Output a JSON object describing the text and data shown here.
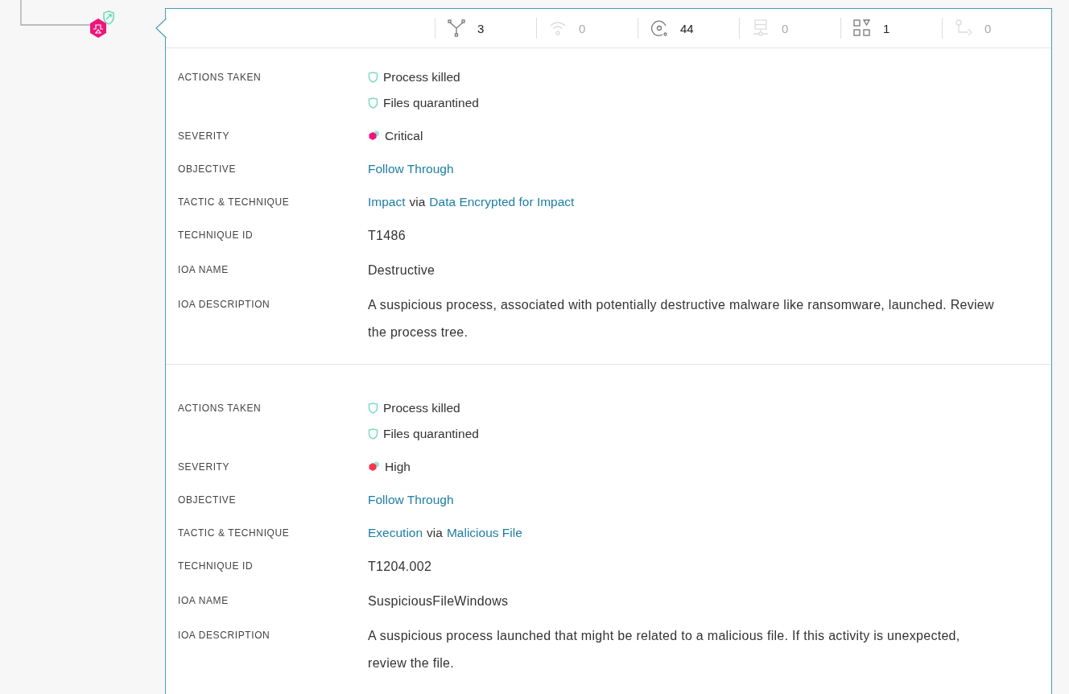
{
  "stats": [
    {
      "kind": "branch",
      "value": "3",
      "disabled": false
    },
    {
      "kind": "network",
      "value": "0",
      "disabled": true
    },
    {
      "kind": "disk",
      "value": "44",
      "disabled": false
    },
    {
      "kind": "server",
      "value": "0",
      "disabled": true
    },
    {
      "kind": "grid",
      "value": "1",
      "disabled": false
    },
    {
      "kind": "flow",
      "value": "0",
      "disabled": true
    }
  ],
  "detections": [
    {
      "rows": [
        {
          "kind": "actions",
          "label": "ACTIONS TAKEN",
          "items": [
            "Process killed",
            "Files quarantined"
          ]
        },
        {
          "kind": "severity",
          "label": "SEVERITY",
          "value": "Critical",
          "color": "#f0157a"
        },
        {
          "kind": "link",
          "label": "OBJECTIVE",
          "value": "Follow Through"
        },
        {
          "kind": "tactic",
          "label": "TACTIC & TECHNIQUE",
          "tactic": "Impact",
          "joiner": "via",
          "technique": "Data Encrypted for Impact"
        },
        {
          "kind": "text",
          "label": "TECHNIQUE ID",
          "value": "T1486"
        },
        {
          "kind": "text",
          "label": "IOA NAME",
          "value": "Destructive"
        },
        {
          "kind": "text",
          "label": "IOA DESCRIPTION",
          "value": "A suspicious process, associated with potentially destructive malware like ransomware, launched. Review the process tree."
        }
      ]
    },
    {
      "rows": [
        {
          "kind": "actions",
          "label": "ACTIONS TAKEN",
          "items": [
            "Process killed",
            "Files quarantined"
          ]
        },
        {
          "kind": "severity",
          "label": "SEVERITY",
          "value": "High",
          "color": "#f2384e"
        },
        {
          "kind": "link",
          "label": "OBJECTIVE",
          "value": "Follow Through"
        },
        {
          "kind": "tactic",
          "label": "TACTIC & TECHNIQUE",
          "tactic": "Execution",
          "joiner": "via",
          "technique": "Malicious File"
        },
        {
          "kind": "text",
          "label": "TECHNIQUE ID",
          "value": "T1204.002"
        },
        {
          "kind": "text",
          "label": "IOA NAME",
          "value": "SuspiciousFileWindows"
        },
        {
          "kind": "text",
          "label": "IOA DESCRIPTION",
          "value": "A suspicious process launched that might be related to a malicious file. If this activity is unexpected, review the file."
        }
      ]
    }
  ]
}
